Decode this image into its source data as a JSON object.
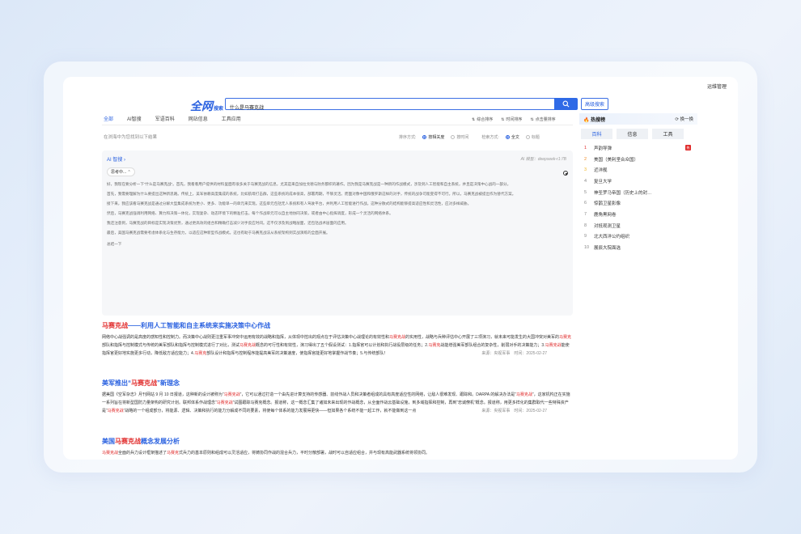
{
  "top_link": "运维管理",
  "logo": {
    "main": "全网",
    "sub": "搜索"
  },
  "search": {
    "value": "什么是马赛克战"
  },
  "advanced_button": "高级搜索",
  "tabs": [
    "全部",
    "AI智搜",
    "军语百科",
    "网站信息",
    "工具应用"
  ],
  "sorts": [
    "综合排序",
    "时间排序",
    "点击量排序"
  ],
  "result_count": "在浏海中为您找到以下结果",
  "filters": {
    "sort_label": "排序方式:",
    "sort_options": [
      "按相关度",
      "按时间"
    ],
    "search_label": "检索方式:",
    "search_options": [
      "全文",
      "标题"
    ]
  },
  "ai": {
    "title": "AI 智搜 ›",
    "model": "AI 模型：deepseek-r1:7B",
    "thinking": "思考中... ⌃",
    "paragraphs": [
      "好，我现在要分析一下“什么是马赛克战”。首先，我看看用户提供的材料里面有很多关于马赛克战的信息，尤其是来自加拉戈德与防务都织的著作。因为我是马赛克战是一种新的作战模式，涉及到人工智能和自主系统，并且是决策中心战的一部分。",
      "首先，我需要理解为什么要提出这种新思路。传统上，美军依赖高度集成的系统，比如航母打击群，这些系统的成本很高，部署周期，不够灵活。而面对像中国和俄罗斯这样的对手，传统的战争可能变得不可行。所以，马赛克战被提出作为替代方案。",
      "接下来，我应该看马赛克战是通过分解大型集成系统为更小、更多、功能单一的单元来实现。这些单元包括无人系统和有人驾驶平台，并利用人工智能进行作战。这种分散式的结构能够提高适应性和灵活性，应对多样威胁。",
      "然后，马赛克战强调利用网络、算力和决策一体化，实现复杂、动态环境下的精准打击。每个作战单元可以自主地协同决策，或者由中心指挥调度，形成一个灵活的网络体系。",
      "我还注意到，马赛克战的目标是实现决策优势，通过更高效的组合和精确打击减少对手反应时间。这不仅涉及到战略层面，还包括战术层面的应用。",
      "最后，美国马赛克战需要考虑体系化与生存能力，以适应这种新型作战模式。这也有助于马赛克战法从系统架构到实战演练的全面开展。"
    ],
    "footer": "总结一下"
  },
  "results": [
    {
      "title_hl": "马赛克战",
      "title_rest": "——利用人工智能和自主系统来实施决策中心作战",
      "body": [
        {
          "t": "网络中心战强调的是高度的感知性和控制力。而决策中心战则更注重军事冲突中运用有效的战略和指挥，从体现中控出的观点在于评估决策中心战理论的有效性和"
        },
        {
          "t": "马赛克战",
          "hl": true
        },
        {
          "t": "的实用性，战略与兵种评估中心开展了三项演习，就未来可能发生的大国冲突对美军的"
        },
        {
          "t": "马赛克",
          "hl": true
        },
        {
          "t": "部队和指挥与控制模式与传统的美军部队和指挥与控制模式进行了对比，测试"
        },
        {
          "t": "马赛克战",
          "hl": true
        },
        {
          "t": "概念的可行性和有效性，演习得出了五个假设测试：1.指挥官可以计划和执行战役层级的任务；2."
        },
        {
          "t": "马赛克",
          "hl": true
        },
        {
          "t": "战能增强美军部队组合的复杂性，削弱对手的决策能力；3."
        },
        {
          "t": "马赛克战",
          "hl": true
        },
        {
          "t": "能使指挥官更好地实施更多行动，降低敌方适应能力；4."
        },
        {
          "t": "马赛克",
          "hl": true
        },
        {
          "t": "部队设计和指挥与控制程序能提高美军的决策速度，使指挥官能更好地掌握作战节奏；5.与传统部队！"
        }
      ],
      "source": "来源：央视军事　时间：2025-02-27"
    },
    {
      "title_rest_pre": "美军推出“",
      "title_hl": "马赛克战",
      "title_rest": "”新理念",
      "body": [
        {
          "t": "据美国《空军杂志》月刊网站 9 月 10 日报道，这种新的设计被称为“"
        },
        {
          "t": "马赛克战",
          "hl": true
        },
        {
          "t": "”，它可以通过打造一个由先进计算支持的传感器、前线作战人员和决策者组成的具有高度适应性的网络，让敌人很难发现、跟踪和。DARPA 的解决办法是“"
        },
        {
          "t": "马赛克战",
          "hl": true
        },
        {
          "t": "”，这家机构正在实施一系列旨在将新型国防力量架构的研究计划。联邦体系作战理念“"
        },
        {
          "t": "马赛克战",
          "hl": true
        },
        {
          "t": "”试图跟踪马赛克概念。报道称，这一概念汇集了诸如未来出现的作战概念，从全面作战云基础设施，到多域指挥和控制，再到“忠诚僚机”概念。报道称，用更多样化的集群取代一些特殊资产是“"
        },
        {
          "t": "马赛克战",
          "hl": true
        },
        {
          "t": "”战略的一个组成部分，将能源、逻辑、决策和执行的能力分解成不同的要素，将使每个体系的能力发展得更快——但如果各个系统不能一起工作，就不能做到这一点"
        }
      ],
      "source": "来源：央视军事　时间：2025-02-27"
    },
    {
      "title_pre": "美国",
      "title_hl": "马赛克战",
      "title_rest": "概念发展分析",
      "body": [
        {
          "t": "马赛克战",
          "hl": true
        },
        {
          "t": "全面的兵力设计框架描述了"
        },
        {
          "t": "马赛克",
          "hl": true
        },
        {
          "t": "式兵力的基本原则和组成可以灵活适应，将铸协同作战的混合兵力，平时分散部署，战时可以自适应组合，并与现有高能武器系统将领协同。"
        }
      ]
    }
  ],
  "hot": {
    "title": "热搜榜",
    "change": "换一换",
    "tabs": [
      "百科",
      "信息",
      "工具"
    ],
    "items": [
      {
        "rank": "1",
        "label": "声韵导弹",
        "badge": "热"
      },
      {
        "rank": "2",
        "label": "美国（美利坚合众国）"
      },
      {
        "rank": "3",
        "label": "近洋舰"
      },
      {
        "rank": "4",
        "label": "复旦大学"
      },
      {
        "rank": "5",
        "label": "神圣罗马帝国（历史上的封…"
      },
      {
        "rank": "6",
        "label": "惊鹊卫星影像"
      },
      {
        "rank": "7",
        "label": "鹿角黑网卷"
      },
      {
        "rank": "8",
        "label": "对抵观测卫星"
      },
      {
        "rank": "9",
        "label": "北大西洋公约组织"
      },
      {
        "rank": "10",
        "label": "展辰大院面选"
      }
    ]
  }
}
